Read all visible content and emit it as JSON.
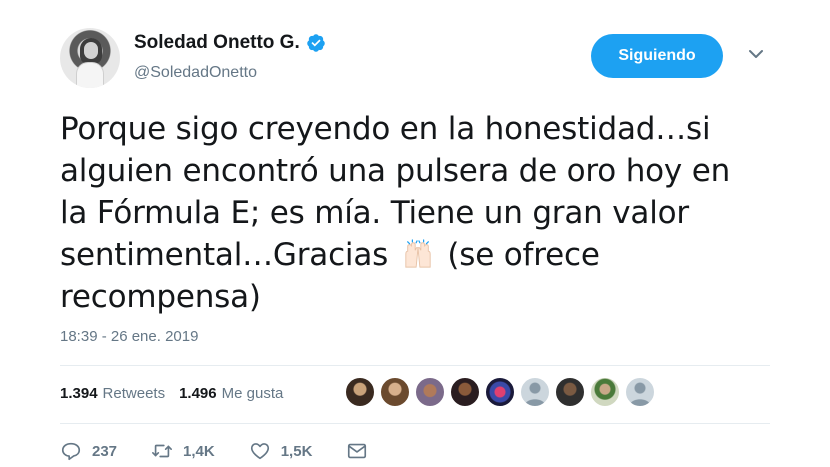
{
  "author": {
    "name": "Soledad Onetto G.",
    "handle": "@SoledadOnetto",
    "verified": true
  },
  "follow_button": {
    "label": "Siguiendo",
    "color": "#1da1f2"
  },
  "tweet": {
    "lines": [
      "Porque sigo creyendo en la honestidad…si",
      "alguien encontró una pulsera de oro hoy en",
      "la Fórmula E; es mía. Tiene un gran valor",
      "sentimental…Gracias",
      "(se ofrece",
      "recompensa)"
    ],
    "emoji": "raising-hands-icon"
  },
  "timestamp": "18:39 - 26 ene. 2019",
  "stats": {
    "retweets_count": "1.394",
    "retweets_label": "Retweets",
    "likes_count": "1.496",
    "likes_label": "Me gusta"
  },
  "actions": {
    "replies": "237",
    "retweets": "1,4K",
    "likes": "1,5K"
  },
  "colors": {
    "text": "#14171a",
    "secondary": "#657786",
    "accent": "#1da1f2",
    "divider": "#e6ecf0"
  }
}
